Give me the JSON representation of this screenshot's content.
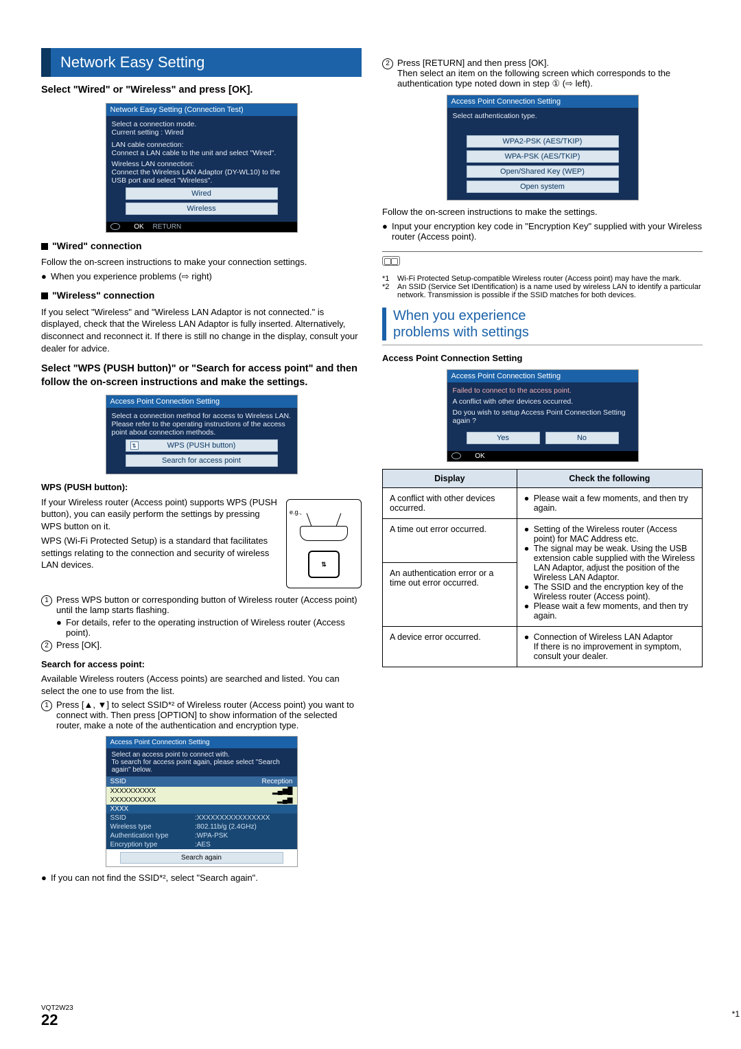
{
  "left": {
    "section_title": "Network Easy Setting",
    "step1_heading": "Select \"Wired\" or \"Wireless\" and press [OK].",
    "dialog1": {
      "title": "Network Easy Setting (Connection Test)",
      "line1": "Select a connection mode.",
      "line2": "Current setting            : Wired",
      "line3": "LAN cable connection:",
      "line4": "  Connect a LAN cable to the unit and select \"Wired\".",
      "line5": "Wireless LAN connection:",
      "line6": "  Connect the Wireless LAN Adaptor (DY-WL10) to the USB port and select \"Wireless\".",
      "btn_wired": "Wired",
      "btn_wireless": "Wireless",
      "ok": "OK",
      "return": "RETURN"
    },
    "wired_hdr": "\"Wired\" connection",
    "wired_p1": "Follow the on-screen instructions to make your connection settings.",
    "wired_b1": "When you experience problems (⇨ right)",
    "wireless_hdr": "\"Wireless\" connection",
    "wireless_p1": "If you select \"Wireless\" and \"Wireless LAN Adaptor is not connected.\" is displayed, check that the Wireless LAN Adaptor is fully inserted. Alternatively, disconnect and reconnect it. If there is still no change in the display, consult your dealer for advice.",
    "step2_heading": "Select \"WPS (PUSH button)\" or \"Search for access point\" and then follow the on-screen instructions and make the settings.",
    "dialog2": {
      "title": "Access Point Connection Setting",
      "line1": "Select a connection method for access to Wireless LAN.",
      "line2": "Please refer to the operating instructions of the access point about connection methods.",
      "btn_wps": "WPS (PUSH button)",
      "btn_search": "Search for access point"
    },
    "wps_hdr": "WPS (PUSH button):",
    "wps_p1": "If your Wireless router (Access point) supports WPS (PUSH button), you can easily perform the settings by pressing WPS button on it.",
    "wps_p2": "WPS (Wi-Fi Protected Setup) is a standard that facilitates settings relating to the connection and security of wireless LAN devices.",
    "wps_eg": "e.g.,",
    "wps_star": "*1",
    "wps_n1": "Press WPS button or corresponding button of Wireless router (Access point) until the lamp starts flashing.",
    "wps_n1b": "For details, refer to the operating instruction of Wireless router (Access point).",
    "wps_n2": "Press [OK].",
    "search_hdr": "Search for access point:",
    "search_p1": "Available Wireless routers (Access points) are searched and listed. You can select the one to use from the list.",
    "search_n1": "Press [▲, ▼] to select SSID*² of Wireless router (Access point) you want to connect with. Then press [OPTION] to show information of the selected router, make a note of the authentication and encryption type.",
    "ssid_dialog": {
      "title": "Access Point Connection Setting",
      "instr": "Select an access point to connect with.\nTo search for access point again, please select \"Search again\" below.",
      "col1": "SSID",
      "col2": "Reception",
      "row1": "XXXXXXXXXX",
      "row2": "XXXXXXXXXX",
      "row_sel": "XXXX",
      "d_ssid_lbl": "SSID",
      "d_ssid_val": ":XXXXXXXXXXXXXXXX",
      "d_type_lbl": "Wireless type",
      "d_type_val": ":802.11b/g  (2.4GHz)",
      "d_auth_lbl": "Authentication type",
      "d_auth_val": ":WPA-PSK",
      "d_enc_lbl": "Encryption type",
      "d_enc_val": ":AES",
      "again": "Search again"
    },
    "search_note": "If you can not find the SSID*², select \"Search again\"."
  },
  "right": {
    "n2": "Press [RETURN] and then press [OK].",
    "n2b": "Then select an item on the following screen which corresponds to the authentication type noted down in step ① (⇨ left).",
    "dialog3": {
      "title": "Access Point Connection Setting",
      "line1": "Select authentication type.",
      "opt1": "WPA2-PSK (AES/TKIP)",
      "opt2": "WPA-PSK (AES/TKIP)",
      "opt3": "Open/Shared Key (WEP)",
      "opt4": "Open system"
    },
    "after1": "Follow the on-screen instructions to make the settings.",
    "after_b1": "Input your encryption key code in \"Encryption Key\" supplied with your Wireless router (Access point).",
    "fn1_lbl": "*1",
    "fn1": "Wi-Fi Protected Setup-compatible Wireless router (Access point) may have the mark.",
    "fn2_lbl": "*2",
    "fn2": "An SSID (Service Set IDentification) is a name used by wireless LAN to identify a particular network. Transmission is possible if the SSID matches for both devices.",
    "trouble_title1": "When you experience",
    "trouble_title2": "problems with settings",
    "ap_hdr": "Access Point Connection Setting",
    "dialog4": {
      "title": "Access Point Connection Setting",
      "l1": "Failed to connect to the access point.",
      "l2": "A conflict with other devices occurred.",
      "l3": "Do you wish to setup Access Point Connection Setting again ?",
      "yes": "Yes",
      "no": "No",
      "ok": "OK"
    },
    "table": {
      "h1": "Display",
      "h2": "Check the following",
      "r1c1": "A conflict with other devices occurred.",
      "r1c2": "Please wait a few moments, and then try again.",
      "r2c1": "A time out error occurred.",
      "r2c2a": "Setting of the Wireless router (Access point) for MAC Address etc.",
      "r2c2b": "The signal may be weak. Using the USB extension cable supplied with the Wireless LAN Adaptor, adjust the position of the Wireless LAN Adaptor.",
      "r3c1": "An authentication error or a time out error occurred.",
      "r3c2a": "The SSID and the encryption key of the Wireless router (Access point).",
      "r3c2b": "Please wait a few moments, and then try again.",
      "r4c1": "A device error occurred.",
      "r4c2": "Connection of Wireless LAN Adaptor\nIf there is no improvement in symptom, consult your dealer."
    }
  },
  "footer": {
    "code": "VQT2W23",
    "page": "22"
  }
}
